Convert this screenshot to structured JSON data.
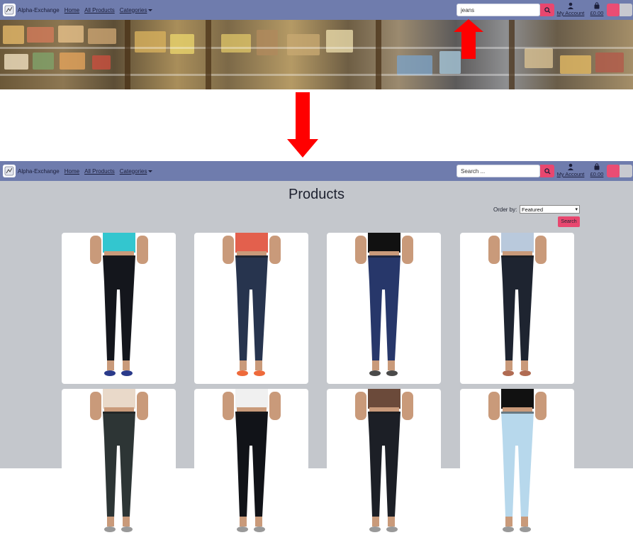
{
  "navbar": {
    "brand": "Alpha-Exchange",
    "links": [
      "Home",
      "All Products",
      "Categories"
    ],
    "account_label": "My Account",
    "cart_total": "£0.00"
  },
  "top_search": {
    "value": "jeans"
  },
  "bottom_search": {
    "placeholder": "Search ..."
  },
  "products_page": {
    "title": "Products",
    "order_label": "Order by:",
    "order_selected": "Featured",
    "search_button": "Search"
  },
  "products": [
    {
      "top_color": "#33c6cf",
      "jeans_color": "#14161c",
      "shoe": "#2a3a8a"
    },
    {
      "top_color": "#e3604d",
      "jeans_color": "#27344e",
      "shoe": "#ee6a3b"
    },
    {
      "top_color": "#111111",
      "jeans_color": "#27376a",
      "shoe": "#4a4a4a"
    },
    {
      "top_color": "#b9c9dc",
      "jeans_color": "#1e2430",
      "shoe": "#b06b52"
    },
    {
      "top_color": "#e9d9c9",
      "jeans_color": "#2d3535",
      "shoe": "#999999"
    },
    {
      "top_color": "#f0f0f0",
      "jeans_color": "#111318",
      "shoe": "#999999"
    },
    {
      "top_color": "#6b4a3a",
      "jeans_color": "#1c1f26",
      "shoe": "#999999"
    },
    {
      "top_color": "#111111",
      "jeans_color": "#b7d8ec",
      "shoe": "#999999"
    }
  ],
  "colors": {
    "navbar": "#6f7cad",
    "accent": "#e8476f",
    "page_bg": "#c4c7cc",
    "arrow": "#ff0000"
  },
  "icons": [
    "logo-icon",
    "search-icon",
    "user-icon",
    "shopping-bag-icon",
    "caret-down-icon",
    "arrow-up-icon",
    "arrow-down-icon"
  ]
}
